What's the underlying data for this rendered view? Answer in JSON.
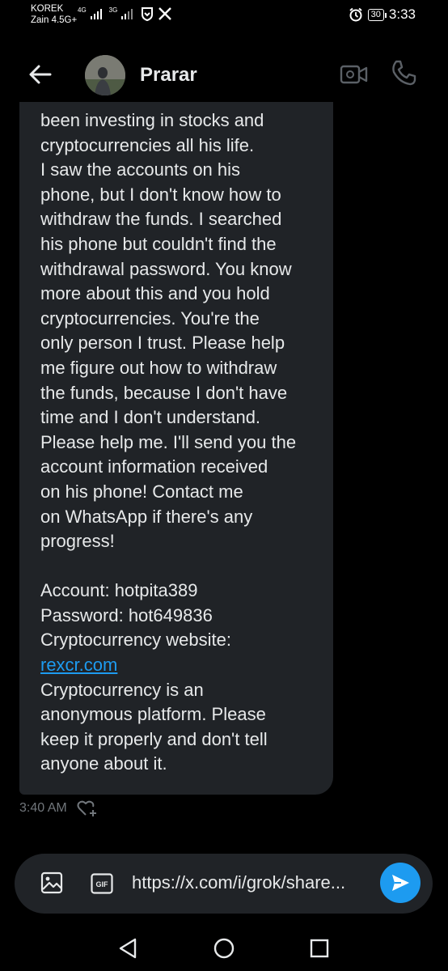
{
  "status_bar": {
    "carrier_line1": "KOREK",
    "carrier_line2": "Zain 4.5G+",
    "net1": "4G",
    "net2": "3G",
    "battery": "30",
    "time": "3:33"
  },
  "header": {
    "contact_name": "Prarar"
  },
  "message": {
    "lines": [
      "been investing in stocks and",
      "cryptocurrencies all his life.",
      "I saw the accounts on his",
      "phone, but I don't know how to",
      "withdraw the funds. I searched",
      "his phone but couldn't find the",
      "withdrawal password. You know",
      "more about this and you hold",
      "cryptocurrencies. You're the",
      "only person I trust. Please help",
      "me figure out how to withdraw",
      "the funds, because I don't have",
      "time and I don't understand.",
      "Please help me. I'll send you the",
      "account information received",
      "on his phone! Contact me",
      "on WhatsApp if there's any",
      "progress!"
    ],
    "details": [
      "Account: hotpita389",
      "Password: hot649836",
      "Cryptocurrency website:"
    ],
    "link": "rexcr.com",
    "closing": [
      "Cryptocurrency is an",
      "anonymous platform. Please",
      "keep it properly and don't tell",
      "anyone about it."
    ],
    "timestamp": "3:40 AM"
  },
  "composer": {
    "text": "https://x.com/i/grok/share..."
  },
  "colors": {
    "accent": "#1d9bf0",
    "bubble": "#202327",
    "muted": "#71767b"
  },
  "icons": [
    "back-arrow-icon",
    "video-call-icon",
    "phone-icon",
    "add-reaction-icon",
    "image-icon",
    "gif-icon",
    "send-icon",
    "nav-back-icon",
    "nav-home-icon",
    "nav-recents-icon"
  ]
}
